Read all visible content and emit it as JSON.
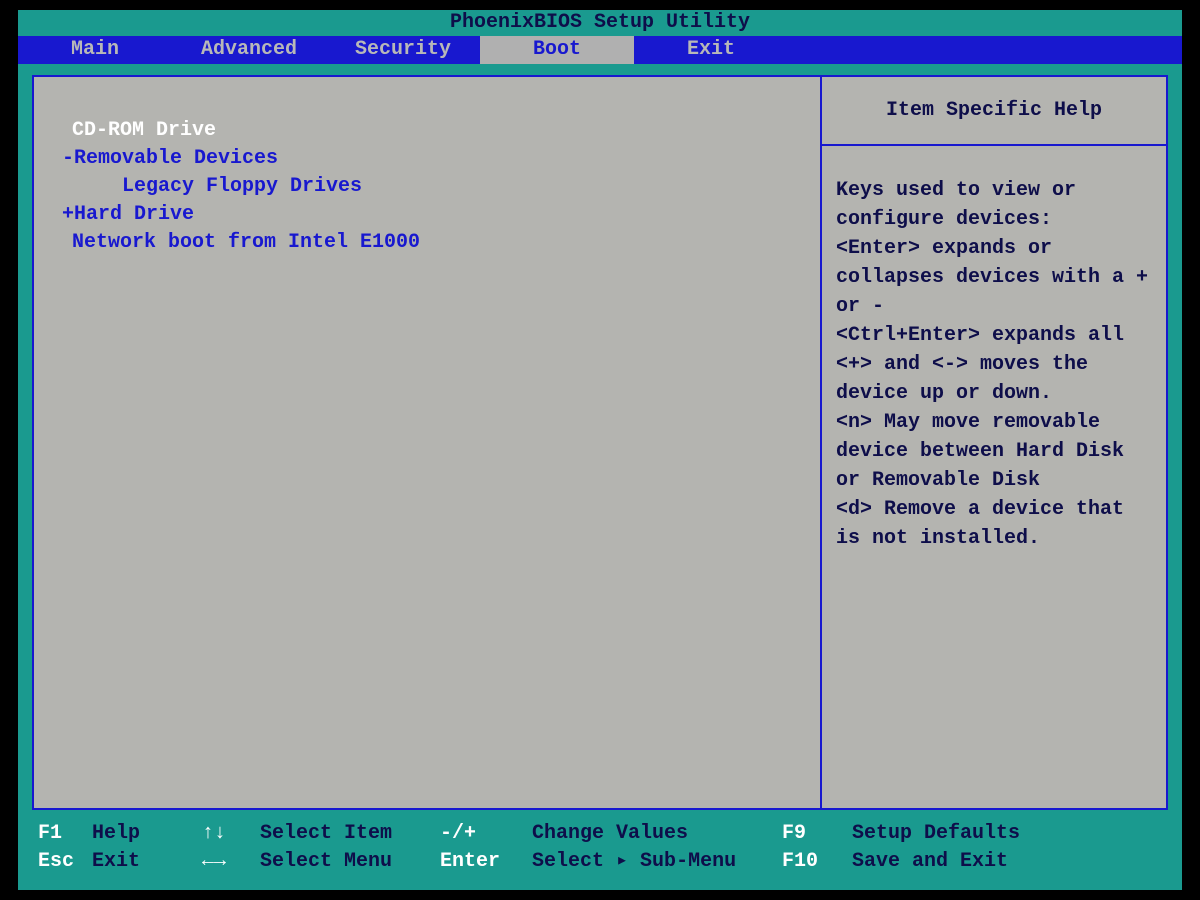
{
  "title": "PhoenixBIOS Setup Utility",
  "tabs": {
    "main": "Main",
    "advanced": "Advanced",
    "security": "Security",
    "boot": "Boot",
    "exit": "Exit"
  },
  "boot_items": {
    "item0": "CD-ROM Drive",
    "item1": "-Removable Devices",
    "item2": "Legacy Floppy Drives",
    "item3": "+Hard Drive",
    "item4": "Network boot from Intel E1000"
  },
  "help": {
    "title": "Item Specific Help",
    "body": "Keys used to view or configure devices:\n<Enter> expands or collapses devices with a + or -\n<Ctrl+Enter> expands all\n<+> and <-> moves the device up or down.\n<n> May move removable device between Hard Disk or Removable Disk\n<d> Remove a device that is not installed."
  },
  "footer": {
    "row1": {
      "k1": "F1",
      "l1": "Help",
      "k2": "↑↓",
      "l2": "Select Item",
      "k3": "-/+",
      "l3": "Change Values",
      "k4": "F9",
      "l4": "Setup Defaults"
    },
    "row2": {
      "k1": "Esc",
      "l1": "Exit",
      "k2": "←→",
      "l2": "Select Menu",
      "k3": "Enter",
      "l3": "Select ▸ Sub-Menu",
      "k4": "F10",
      "l4": "Save and Exit"
    }
  }
}
